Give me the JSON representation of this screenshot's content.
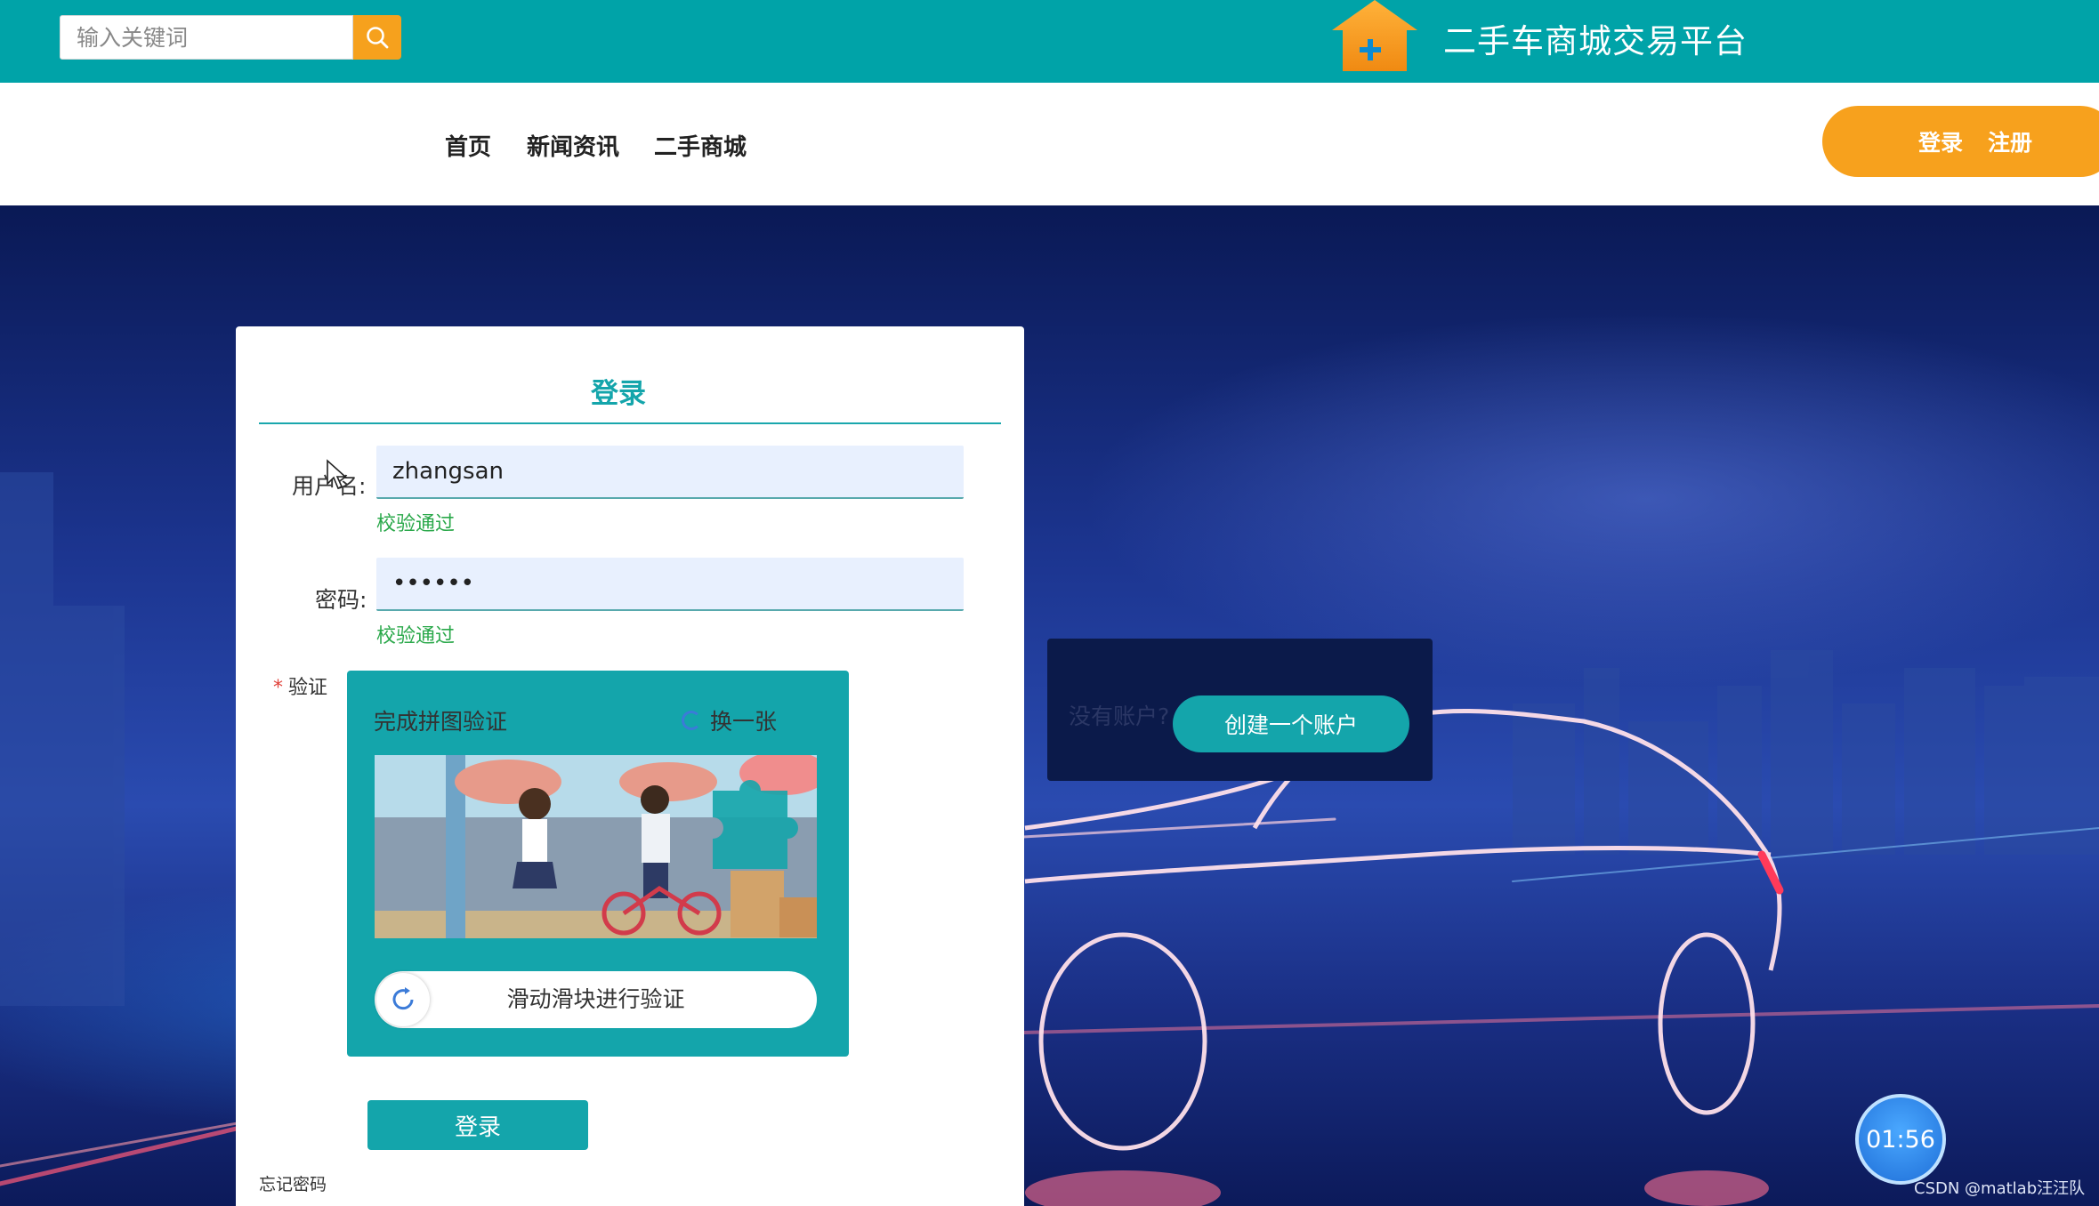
{
  "header": {
    "search_placeholder": "输入关键词",
    "site_title": "二手车商城交易平台",
    "brand_color": "#00a3a8",
    "accent_color": "#f7a11d"
  },
  "nav": {
    "items": [
      {
        "label": "首页"
      },
      {
        "label": "新闻资讯"
      },
      {
        "label": "二手商城"
      }
    ],
    "login_label": "登录",
    "register_label": "注册"
  },
  "login_form": {
    "title": "登录",
    "username_label": "用户名:",
    "username_value": "zhangsan",
    "username_valid": "校验通过",
    "password_label": "密码:",
    "password_value": "••••••",
    "password_valid": "校验通过",
    "verify_label": "验证",
    "captcha_title": "完成拼图验证",
    "captcha_refresh": "换一张",
    "slider_text": "滑动滑块进行验证",
    "submit_label": "登录",
    "forgot_label": "忘记密码"
  },
  "register_box": {
    "question": "没有账户?",
    "button": "创建一个账户"
  },
  "overlay": {
    "timer": "01:56",
    "watermark": "CSDN @matlab汪汪队"
  },
  "icons": {
    "search": "search-icon",
    "logo": "house-plus-logo",
    "refresh": "refresh-icon",
    "slider": "rotate-arrow-icon"
  }
}
